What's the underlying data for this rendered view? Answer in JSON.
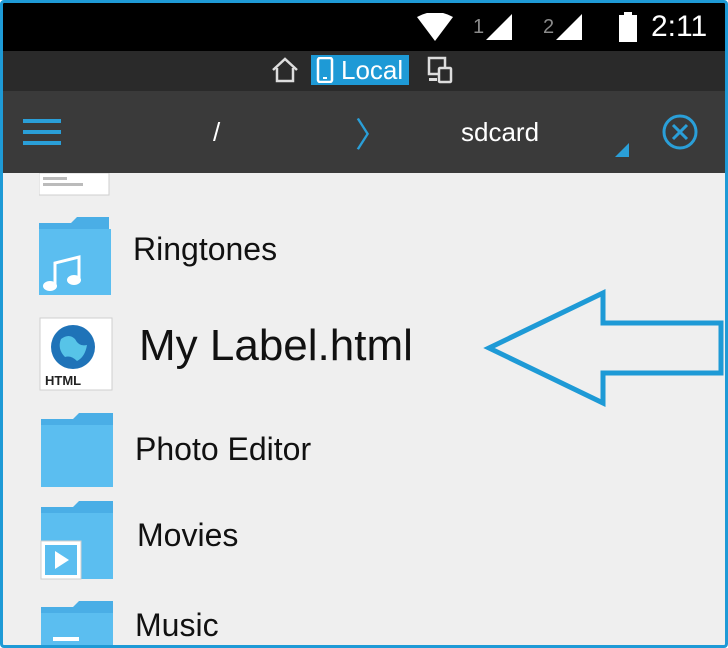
{
  "status_bar": {
    "icons": [
      "wifi-icon",
      "signal-icon",
      "signal-icon",
      "battery-icon"
    ],
    "sim1": "1",
    "sim2": "2",
    "time": "2:11"
  },
  "tabs": {
    "home_icon": "home-icon",
    "local_label": "Local",
    "remote_icon": "devices-icon"
  },
  "toolbar": {
    "menu_icon": "menu-icon",
    "root": "/",
    "separator": "〉",
    "current_folder": "sdcard",
    "close_icon": "close-icon"
  },
  "files": [
    {
      "name": "Ringtones",
      "icon": "music-folder-icon"
    },
    {
      "name": "My Label.html",
      "icon": "html-file-icon"
    },
    {
      "name": "Photo Editor",
      "icon": "folder-icon"
    },
    {
      "name": "Movies",
      "icon": "video-folder-icon"
    },
    {
      "name": "Music",
      "icon": "music-folder-icon"
    }
  ],
  "annotation": {
    "icon": "arrow-left-icon"
  },
  "colors": {
    "accent": "#1e9ad6",
    "folder": "#5bbef0",
    "toolbar": "#3a3a3a"
  }
}
